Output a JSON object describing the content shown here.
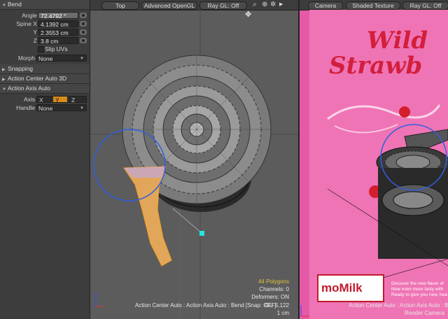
{
  "panel": {
    "bend_title": "Bend",
    "angle_label": "Angle",
    "angle_value": "72.4792 °",
    "spine_x_label": "Spine X",
    "spine_x_value": "4.1392 cm",
    "y_label": "Y",
    "y_value": "2.3553 cm",
    "z_label": "Z",
    "z_value": "3.8 cm",
    "slip_uvs_label": "Slip UVs",
    "morph_label": "Morph",
    "morph_value": "None",
    "snapping": "Snapping",
    "action_center": "Action Center Auto 3D",
    "action_axis": "Action Axis Auto",
    "axis_label": "Axis",
    "axis_x": "X",
    "axis_y": "Y",
    "axis_z": "Z",
    "axis_selected": "Y",
    "handle_label": "Handle",
    "handle_value": "None"
  },
  "viewport1": {
    "view_label": "Top",
    "shading_label": "Advanced OpenGL",
    "raygl_label": "Ray GL: Off",
    "polygons": "44 Polygons",
    "channels": "Channels: 0",
    "deformers": "Deformers: ON",
    "gl": "GL: 5,122",
    "scale": "1 cm",
    "status": "Action Center Auto : Action Axis Auto : Bend [Snap: OFF]"
  },
  "viewport2": {
    "view_label": "Camera",
    "shading_label": "Shaded Texture",
    "raygl_label": "Ray GL: Off",
    "status": "Action Center Auto : Action Axis Auto : Bend",
    "camera_label": "Render Camera",
    "ad_title_1": "Wild",
    "ad_title_2": "Strawb",
    "logo_text": "moMilk",
    "ad_text_1": "Discover the new flavor of",
    "ad_text_2": "Now even more tasty with",
    "ad_text_3": "Ready to give you new, hea"
  },
  "colors": {
    "accent_orange": "#d98c1a",
    "gizmo_blue": "#2f5fe0",
    "ad_pink": "#e55aa6",
    "brand_red": "#c01a2c"
  }
}
